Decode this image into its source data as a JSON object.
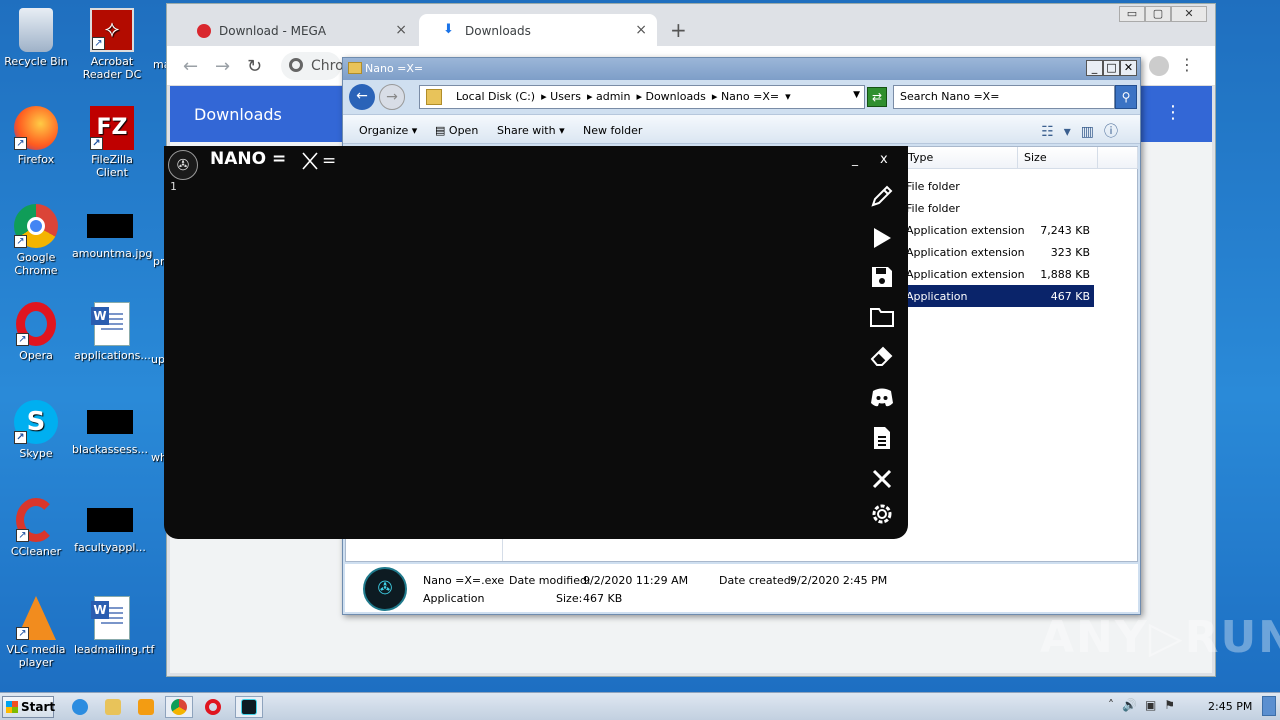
{
  "desktop": {
    "icons": [
      {
        "label": "Recycle Bin"
      },
      {
        "label": "Acrobat Reader DC"
      },
      {
        "label": "Firefox"
      },
      {
        "label": "FileZilla Client"
      },
      {
        "label": "Google Chrome"
      },
      {
        "label": "amountma.jpg"
      },
      {
        "label": "Opera"
      },
      {
        "label": "applications..."
      },
      {
        "label": "Skype"
      },
      {
        "label": "blackassess..."
      },
      {
        "label": "CCleaner"
      },
      {
        "label": "facultyappl..."
      },
      {
        "label": "VLC media player"
      },
      {
        "label": "leadmailing.rtf"
      }
    ],
    "partial_labels": [
      "ma",
      "pr",
      "up",
      "wh"
    ]
  },
  "chrome": {
    "tabs": [
      {
        "label": "Download - MEGA",
        "close": "×"
      },
      {
        "label": "Downloads",
        "close": "×"
      }
    ],
    "new_tab": "+",
    "omnibox_text": "Chro",
    "downloads_title": "Downloads",
    "menu": "⋮",
    "window_controls": [
      "▭",
      "▢",
      "✕"
    ]
  },
  "explorer": {
    "title": "Nano =X=",
    "breadcrumbs": [
      "Local Disk (C:)",
      "Users",
      "admin",
      "Downloads",
      "Nano =X="
    ],
    "search_placeholder": "Search Nano =X=",
    "commands": {
      "organize": "Organize",
      "open": "Open",
      "share": "Share with",
      "new_folder": "New folder"
    },
    "columns": {
      "type": "Type",
      "size": "Size"
    },
    "rows": [
      {
        "type": "File folder",
        "size": ""
      },
      {
        "type": "File folder",
        "size": ""
      },
      {
        "type": "Application extension",
        "size": "7,243 KB"
      },
      {
        "type": "Application extension",
        "size": "323 KB"
      },
      {
        "type": "Application extension",
        "size": "1,888 KB"
      },
      {
        "type": "Application",
        "size": "467 KB"
      }
    ],
    "details": {
      "name": "Nano =X=.exe",
      "kind": "Application",
      "date_modified_label": "Date modified:",
      "date_modified": "9/2/2020 11:29 AM",
      "date_created_label": "Date created:",
      "date_created": "9/2/2020 2:45 PM",
      "size_label": "Size:",
      "size": "467 KB"
    }
  },
  "nano": {
    "title": "NANO =",
    "title_suffix": "=",
    "minimize": "_",
    "close": "x",
    "line_number": "1",
    "tools": [
      "edit-icon",
      "run-icon",
      "save-icon",
      "open-folder-icon",
      "eraser-icon",
      "discord-icon",
      "document-icon",
      "tools-icon",
      "settings-icon"
    ]
  },
  "watermark": "ANY▷RUN",
  "taskbar": {
    "start": "Start",
    "clock": "2:45 PM"
  }
}
